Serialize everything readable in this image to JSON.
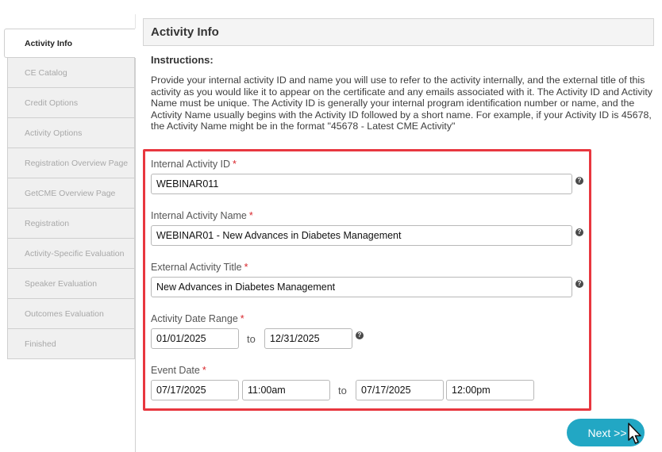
{
  "sidebar": {
    "items": [
      {
        "label": "Activity Info"
      },
      {
        "label": "CE Catalog"
      },
      {
        "label": "Credit Options"
      },
      {
        "label": "Activity Options"
      },
      {
        "label": "Registration Overview Page"
      },
      {
        "label": "GetCME Overview Page"
      },
      {
        "label": "Registration"
      },
      {
        "label": "Activity-Specific Evaluation"
      },
      {
        "label": "Speaker Evaluation"
      },
      {
        "label": "Outcomes Evaluation"
      },
      {
        "label": "Finished"
      }
    ],
    "active_index": 0
  },
  "header": {
    "title": "Activity Info"
  },
  "instructions": {
    "title": "Instructions:",
    "text": "Provide your internal activity ID and name you will use to refer to the activity internally, and the external title of this activity as you would like it to appear on the certificate and any emails associated with it. The Activity ID and Activity Name must be unique. The Activity ID is generally your internal program identification number or name, and the Activity Name usually begins with the Activity ID followed by a short name. For example, if your Activity ID is 45678, the Activity Name might be in the format \"45678 - Latest CME Activity\""
  },
  "form": {
    "required_mark": "*",
    "help_glyph": "?",
    "internal_id": {
      "label": "Internal Activity ID",
      "value": "WEBINAR011"
    },
    "internal_name": {
      "label": "Internal Activity Name",
      "value": "WEBINAR01 - New Advances in Diabetes Management"
    },
    "external_title": {
      "label": "External Activity Title",
      "value": "New Advances in Diabetes Management"
    },
    "date_range": {
      "label": "Activity Date Range",
      "start": "01/01/2025",
      "to": "to",
      "end": "12/31/2025"
    },
    "event_date": {
      "label": "Event Date",
      "start_date": "07/17/2025",
      "start_time": "11:00am",
      "to": "to",
      "end_date": "07/17/2025",
      "end_time": "12:00pm"
    }
  },
  "actions": {
    "next_label": "Next >>"
  },
  "colors": {
    "accent": "#22a7c4",
    "highlight": "#e8373f",
    "required": "#d9262c"
  }
}
